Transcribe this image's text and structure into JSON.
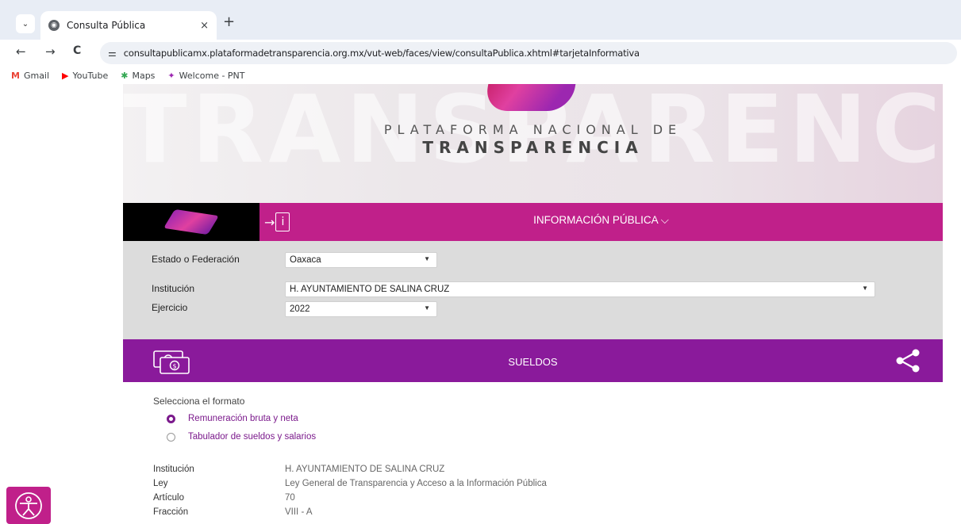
{
  "browser": {
    "tab_title": "Consulta Pública",
    "tab_close": "×",
    "new_tab": "+",
    "tab_dropdown": "⌄",
    "url": "consultapublicamx.plataformadetransparencia.org.mx/vut-web/faces/view/consultaPublica.xhtml#tarjetaInformativa",
    "back": "←",
    "forward": "→",
    "reload": "C",
    "site_info": "⚌",
    "bookmarks": [
      {
        "label": "Gmail",
        "icon": "gmail-icon",
        "glyph": "M",
        "color": "#ea4335"
      },
      {
        "label": "YouTube",
        "icon": "youtube-icon",
        "glyph": "▶",
        "color": "#ff0000"
      },
      {
        "label": "Maps",
        "icon": "maps-icon",
        "glyph": "✱",
        "color": "#34a853"
      },
      {
        "label": "Welcome - PNT",
        "icon": "pnt-icon",
        "glyph": "✦",
        "color": "#9c27b0"
      }
    ]
  },
  "hero": {
    "background_text": "TRANSPARENCIA",
    "line1": "PLATAFORMA NACIONAL DE",
    "line2": "TRANSPARENCIA"
  },
  "nav": {
    "title": "INFORMACIÓN PÚBLICA ⌵",
    "info_arrow": "→",
    "info_letter": "i"
  },
  "filters": {
    "estado_label": "Estado o Federación",
    "estado_value": "Oaxaca",
    "institucion_label": "Institución",
    "institucion_value": "H. AYUNTAMIENTO DE SALINA CRUZ",
    "ejercicio_label": "Ejercicio",
    "ejercicio_value": "2022",
    "caret": "▼"
  },
  "section": {
    "title": "SUELDOS"
  },
  "format": {
    "prompt": "Selecciona el formato",
    "options": [
      {
        "label": "Remuneración bruta y neta",
        "selected": true
      },
      {
        "label": "Tabulador de sueldos y salarios",
        "selected": false
      }
    ]
  },
  "details": [
    {
      "key": "Institución",
      "value": "H. AYUNTAMIENTO DE SALINA CRUZ"
    },
    {
      "key": "Ley",
      "value": "Ley General de Transparencia y Acceso a la Información Pública"
    },
    {
      "key": "Artículo",
      "value": "70"
    },
    {
      "key": "Fracción",
      "value": "VIII - A"
    }
  ],
  "colors": {
    "magenta": "#c0208a",
    "purple": "#8a1a9b",
    "filter_bg": "#dcdcdc"
  }
}
